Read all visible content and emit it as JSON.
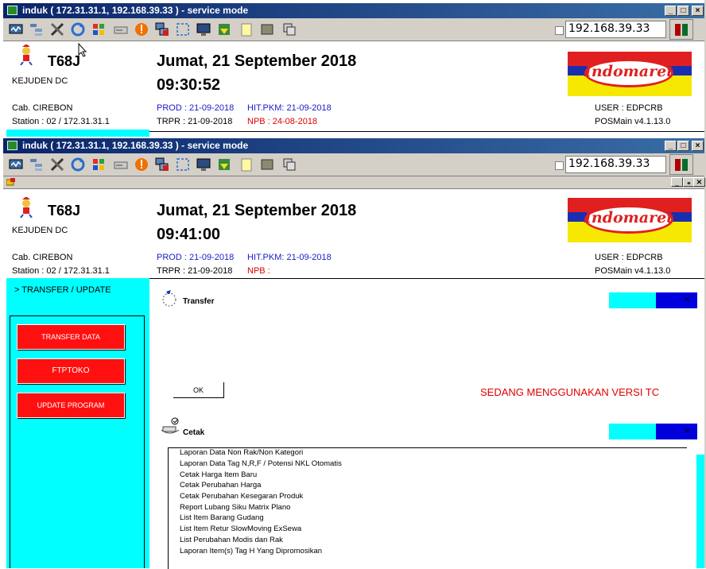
{
  "window": {
    "title": "induk ( 172.31.31.1, 192.168.39.33 ) - service mode",
    "min_label": "_",
    "max_label": "□",
    "close_label": "×"
  },
  "toolbar": {
    "ip_value": "192.168.39.33",
    "icons": [
      "monitor-icon",
      "tree-icon",
      "tools-icon",
      "refresh-icon",
      "windows-icon",
      "drive-icon",
      "warning-icon",
      "network-remove-icon",
      "fullscreen-icon",
      "screen-icon",
      "download-icon",
      "note-icon",
      "box-icon",
      "copy-icon"
    ]
  },
  "header1": {
    "store_code": "T68J",
    "dc_name": "KEJUDEN DC",
    "date": "Jumat, 21 September 2018",
    "time": "09:30:52",
    "branch": "Cab. CIREBON",
    "station": "Station : 02 / 172.31.31.1",
    "prod": "PROD : 21-09-2018",
    "hit_pkm": "HIT.PKM: 21-09-2018",
    "trpr": "TRPR : 21-09-2018",
    "npb": "NPB : 24-08-2018",
    "user": "USER : EDPCRB",
    "version": "POSMain v4.1.13.0",
    "logo_text": "Indomaret"
  },
  "header2": {
    "store_code": "T68J",
    "dc_name": "KEJUDEN DC",
    "date": "Jumat, 21 September 2018",
    "time": "09:41:00",
    "branch": "Cab. CIREBON",
    "station": "Station : 02 / 172.31.31.1",
    "prod": "PROD : 21-09-2018",
    "hit_pkm": "HIT.PKM: 21-09-2018",
    "trpr": "TRPR : 21-09-2018",
    "npb": "NPB :",
    "user": "USER : EDPCRB",
    "version": "POSMain v4.1.13.0",
    "logo_text": "Indomaret"
  },
  "mdi": {
    "min_label": "_",
    "restore_label": "ₑ",
    "close_label": "×"
  },
  "sidebar": {
    "title": "> TRANSFER / UPDATE",
    "buttons": [
      "TRANSFER DATA",
      "FTPTOKO",
      "UPDATE PROGRAM"
    ]
  },
  "transfer": {
    "title": "Transfer",
    "ok_label": "OK",
    "status": "SEDANG MENGGUNAKAN VERSI TC",
    "close_label": "×"
  },
  "cetak": {
    "title": "Cetak",
    "close_label": "×",
    "items": [
      "Laporan Data Non Rak/Non Kategori",
      "Laporan Data Tag N,R,F / Potensi NKL Otomatis",
      "Cetak Harga Item Baru",
      "Cetak Perubahan Harga",
      "Cetak Perubahan Kesegaran Produk",
      "Report Lubang Siku Matrix Plano",
      "List Item Barang Gudang",
      "List Item Retur SlowMoving ExSewa",
      "List Perubahan Modis dan Rak",
      "Laporan Item(s) Tag H Yang Dipromosikan"
    ]
  },
  "colors": {
    "accent_cyan": "#00ffff",
    "button_red": "#ff1010",
    "blue_text": "#1a1acc",
    "red_text": "#e00000"
  }
}
